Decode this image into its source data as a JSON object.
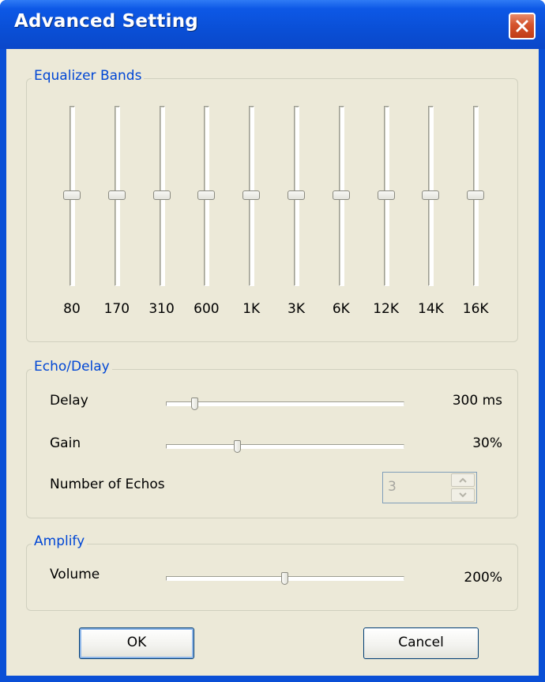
{
  "window": {
    "title": "Advanced Setting"
  },
  "equalizer": {
    "group_label": "Equalizer Bands",
    "bands": [
      {
        "label": "80",
        "level": 0.5
      },
      {
        "label": "170",
        "level": 0.5
      },
      {
        "label": "310",
        "level": 0.5
      },
      {
        "label": "600",
        "level": 0.5
      },
      {
        "label": "1K",
        "level": 0.5
      },
      {
        "label": "3K",
        "level": 0.5
      },
      {
        "label": "6K",
        "level": 0.5
      },
      {
        "label": "12K",
        "level": 0.5
      },
      {
        "label": "14K",
        "level": 0.5
      },
      {
        "label": "16K",
        "level": 0.5
      }
    ]
  },
  "echo": {
    "group_label": "Echo/Delay",
    "delay": {
      "label": "Delay",
      "value_text": "300 ms",
      "level": 0.12
    },
    "gain": {
      "label": "Gain",
      "value_text": "30%",
      "level": 0.3
    },
    "number_of_echos": {
      "label": "Number of Echos",
      "value": "3",
      "disabled": true
    }
  },
  "amplify": {
    "group_label": "Amplify",
    "volume": {
      "label": "Volume",
      "value_text": "200%",
      "level": 0.5
    }
  },
  "buttons": {
    "ok_label": "OK",
    "cancel_label": "Cancel"
  },
  "colors": {
    "title_bar": "#0a4fd6",
    "dialog_background": "#ece9d8",
    "group_label": "#0046d5",
    "close_button": "#d4532c"
  }
}
